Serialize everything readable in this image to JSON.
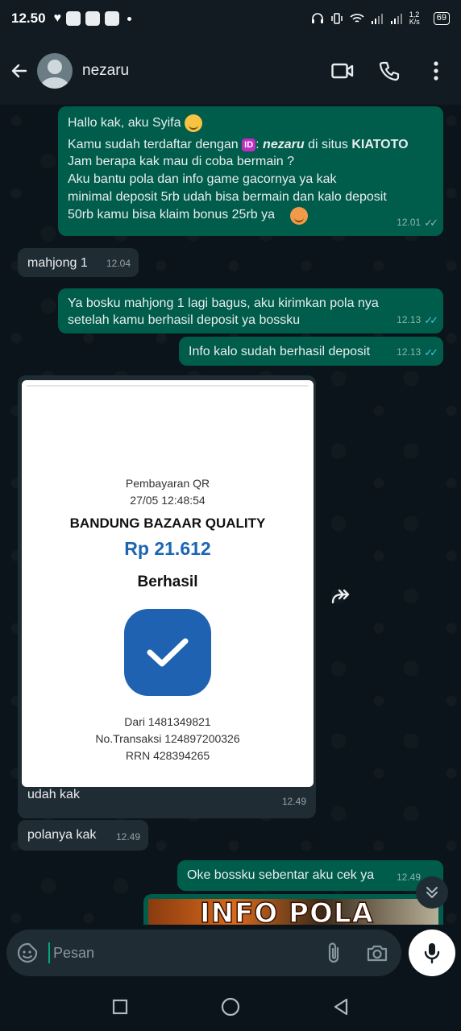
{
  "status_bar": {
    "time": "12.50",
    "network_speed": "1,2 K/s",
    "battery": "69"
  },
  "header": {
    "contact_name": "nezaru"
  },
  "messages": [
    {
      "id": "welcome",
      "direction": "out",
      "line1": "Hallo kak, aku Syifa",
      "line2_pre": "Kamu sudah terdaftar dengan",
      "id_badge": "ID",
      "line2_user": "nezaru",
      "line2_mid": "di situs",
      "line2_site": "KIATOTO",
      "body": "Jam berapa kak mau di coba bermain ?\nAku bantu pola dan info game gacornya ya kak\nminimal deposit 5rb udah bisa bermain dan kalo deposit\n50rb kamu bisa klaim bonus 25rb ya",
      "time": "12.01",
      "status": "delivered"
    },
    {
      "id": "mahjong",
      "direction": "in",
      "text": "mahjong 1",
      "time": "12.04"
    },
    {
      "id": "reply-bosku",
      "direction": "out",
      "text": "Ya bosku mahjong 1 lagi bagus, aku kirimkan pola nya\nsetelah kamu berhasil deposit ya bossku",
      "time": "12.13",
      "status": "read"
    },
    {
      "id": "info-deposit",
      "direction": "out",
      "text": "Info kalo sudah berhasil deposit",
      "time": "12.13",
      "status": "read"
    },
    {
      "id": "udah-kak",
      "direction": "in",
      "text": "udah kak",
      "time": "12.49"
    },
    {
      "id": "polanya",
      "direction": "in",
      "text": "polanya kak",
      "time": "12.49"
    },
    {
      "id": "oke-bossku",
      "direction": "out",
      "text": "Oke bossku sebentar aku cek ya",
      "time": "12.49",
      "status": "delivered"
    }
  ],
  "receipt": {
    "title": "Pembayaran QR",
    "datetime": "27/05 12:48:54",
    "merchant": "BANDUNG BAZAAR QUALITY",
    "amount": "Rp 21.612",
    "status": "Berhasil",
    "from": "Dari 1481349821",
    "transaction": "No.Transaksi 124897200326",
    "rrn": "RRN 428394265"
  },
  "preview_image": {
    "text": "INFO POLA"
  },
  "composer": {
    "placeholder": "Pesan"
  },
  "colors": {
    "outgoing_bubble": "#005c4b",
    "incoming_bubble": "#202c33",
    "chat_background": "#0b141a",
    "read_ticks": "#53bdeb",
    "receipt_amount": "#1a66b3",
    "receipt_check": "#1f62b1"
  }
}
